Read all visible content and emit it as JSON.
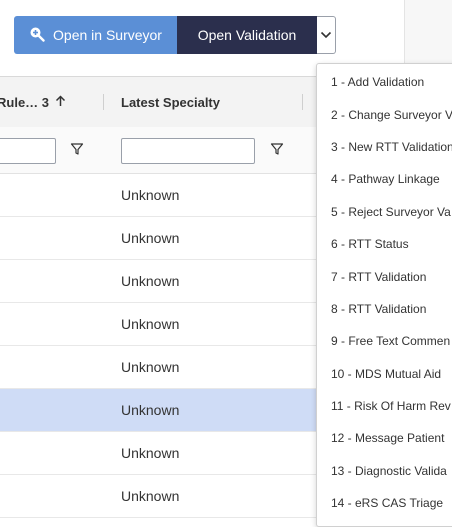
{
  "toolbar": {
    "open_surveyor_label": "Open in Surveyor",
    "open_validation_label": "Open Validation"
  },
  "grid": {
    "columns": [
      {
        "label": "Rule… 3"
      },
      {
        "label": "Latest Specialty"
      }
    ],
    "rows": [
      {
        "latest_specialty": "Unknown",
        "selected": false
      },
      {
        "latest_specialty": "Unknown",
        "selected": false
      },
      {
        "latest_specialty": "Unknown",
        "selected": false
      },
      {
        "latest_specialty": "Unknown",
        "selected": false
      },
      {
        "latest_specialty": "Unknown",
        "selected": false
      },
      {
        "latest_specialty": "Unknown",
        "selected": true
      },
      {
        "latest_specialty": "Unknown",
        "selected": false
      },
      {
        "latest_specialty": "Unknown",
        "selected": false
      }
    ]
  },
  "menu": {
    "items": [
      "1 - Add Validation",
      "2 - Change Surveyor V",
      "3 - New RTT Validation",
      "4 - Pathway Linkage",
      "5 - Reject Surveyor Va",
      "6 - RTT Status",
      "7 - RTT Validation",
      "8 - RTT Validation",
      "9 - Free Text Commen",
      "10 - MDS Mutual Aid",
      "11 - Risk Of Harm Rev",
      "12 - Message Patient",
      "13 - Diagnostic Valida",
      "14 - eRS CAS Triage"
    ]
  },
  "colors": {
    "surveyor_button": "#5b8fd6",
    "validation_button": "#2b2f4d",
    "selected_row": "#cfdcf6"
  },
  "icons": {
    "surveyor": "search-plus-icon",
    "sort": "arrow-up-icon",
    "filter": "funnel-icon",
    "dropdown": "chevron-down-icon"
  }
}
